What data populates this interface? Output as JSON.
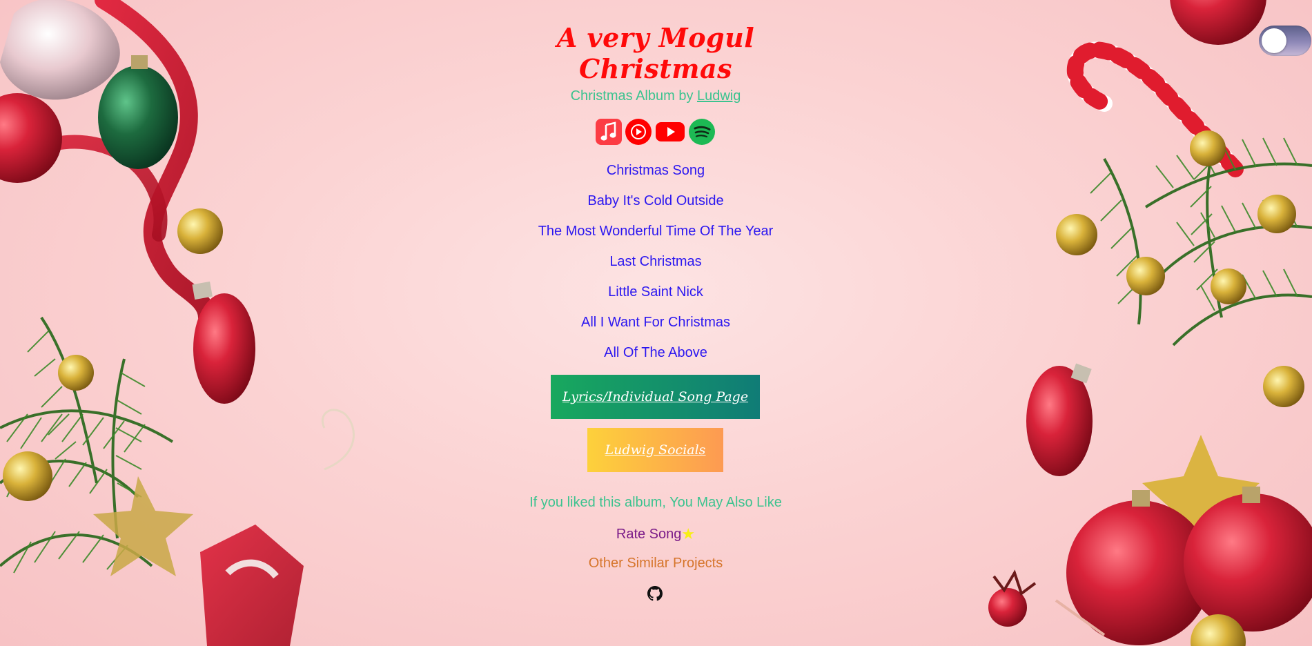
{
  "page": {
    "title": "A very Mogul Christmas",
    "byline_prefix": "Christmas Album by ",
    "byline_link": "Ludwig"
  },
  "theme_toggle": {
    "state": "off"
  },
  "platforms": [
    {
      "name": "Apple Music",
      "icon": "apple-music-icon",
      "color": "#fc3c44"
    },
    {
      "name": "YouTube Music",
      "icon": "youtube-music-icon",
      "color": "#ff0000"
    },
    {
      "name": "YouTube",
      "icon": "youtube-icon",
      "color": "#ff0000"
    },
    {
      "name": "Spotify",
      "icon": "spotify-icon",
      "color": "#1db954"
    }
  ],
  "songs": [
    "Christmas Song",
    "Baby It's Cold Outside",
    "The Most Wonderful Time Of The Year",
    "Last Christmas",
    "Little Saint Nick",
    "All I Want For Christmas",
    "All Of The Above"
  ],
  "buttons": {
    "lyrics": "Lyrics/Individual Song Page",
    "socials": "Ludwig Socials"
  },
  "footer": {
    "also_like": "If you liked this album, You May Also Like",
    "rate_song": "Rate Song",
    "rate_icon": "star-icon",
    "similar_projects": "Other Similar Projects",
    "github_icon": "github-icon"
  },
  "colors": {
    "title": "#ff0a0a",
    "byline": "#3cc38f",
    "song_link": "#2b17f0",
    "rate": "#7a1a88",
    "similar": "#d6752b"
  }
}
